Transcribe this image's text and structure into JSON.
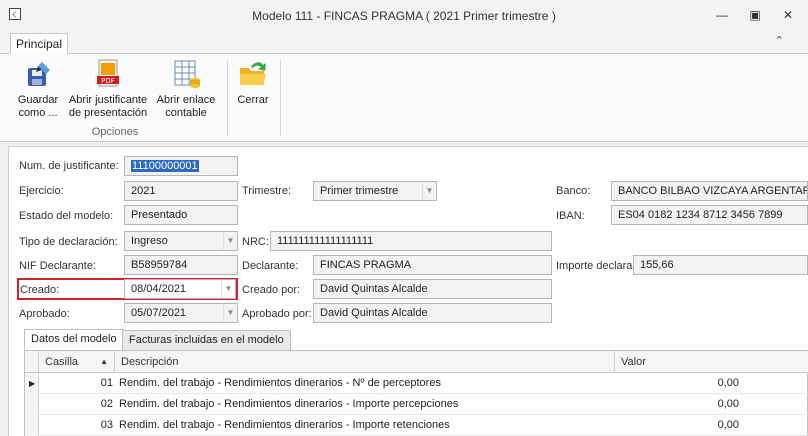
{
  "window": {
    "title": "Modelo 111 - FINCAS PRAGMA ( 2021 Primer trimestre )"
  },
  "ribbon": {
    "tab_label": "Principal",
    "buttons": [
      {
        "label_line1": "Guardar",
        "label_line2": "como ...",
        "icon": "save-as-icon"
      },
      {
        "label_line1": "Abrir justificante",
        "label_line2": "de presentación",
        "icon": "pdf-icon"
      },
      {
        "label_line1": "Abrir enlace",
        "label_line2": "contable",
        "icon": "spreadsheet-icon"
      },
      {
        "label_line1": "Cerrar",
        "label_line2": "",
        "icon": "exit-folder-icon"
      }
    ],
    "group_label": "Opciones"
  },
  "form": {
    "num_justificante": {
      "label": "Num. de justificante:",
      "value": "11100000001"
    },
    "ejercicio": {
      "label": "Ejercicio:",
      "value": "2021"
    },
    "trimestre": {
      "label": "Trimestre:",
      "value": "Primer trimestre"
    },
    "banco": {
      "label": "Banco:",
      "value": "BANCO BILBAO VIZCAYA ARGENTARIA"
    },
    "estado": {
      "label": "Estado del modelo:",
      "value": "Presentado"
    },
    "iban": {
      "label": "IBAN:",
      "value": "ES04 0182 1234 8712 3456 7899"
    },
    "tipo_declaracion": {
      "label": "Tipo de declaración:",
      "value": "Ingreso"
    },
    "nrc": {
      "label": "NRC:",
      "value": "111111111111111111"
    },
    "nif_declarante": {
      "label": "NIF Declarante:",
      "value": "B58959784"
    },
    "declarante": {
      "label": "Declarante:",
      "value": "FINCAS PRAGMA"
    },
    "importe_declarado": {
      "label": "Importe declarado:",
      "value": "155,66"
    },
    "creado": {
      "label": "Creado:",
      "value": "08/04/2021"
    },
    "creado_por": {
      "label": "Creado por:",
      "value": "David Quintas Alcalde"
    },
    "aprobado": {
      "label": "Aprobado:",
      "value": "05/07/2021"
    },
    "aprobado_por": {
      "label": "Aprobado por:",
      "value": "David Quintas Alcalde"
    }
  },
  "tabs": [
    "Datos del modelo",
    "Facturas incluidas en el modelo"
  ],
  "grid": {
    "headers": {
      "casilla": "Casilla",
      "descripcion": "Descripción",
      "valor": "Valor"
    },
    "rows": [
      {
        "casilla": "01",
        "descripcion": "Rendim. del trabajo - Rendimientos dinerarios - Nº de perceptores",
        "valor": "0,00"
      },
      {
        "casilla": "02",
        "descripcion": "Rendim. del trabajo - Rendimientos dinerarios - Importe percepciones",
        "valor": "0,00"
      },
      {
        "casilla": "03",
        "descripcion": "Rendim. del trabajo - Rendimientos dinerarios - Importe retenciones",
        "valor": "0,00"
      }
    ]
  },
  "colors": {
    "highlight": "#d42027",
    "selection": "#2d6bc2"
  }
}
